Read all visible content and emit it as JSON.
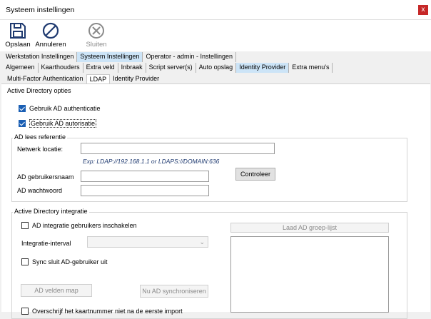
{
  "window": {
    "title": "Systeem instellingen",
    "close": "x"
  },
  "toolbar": {
    "save": "Opslaan",
    "cancel": "Annuleren",
    "close": "Sluiten"
  },
  "tabs_level1": [
    "Werkstation Instellingen",
    "Systeem Instellingen",
    "Operator - admin - Instellingen"
  ],
  "tabs_level2": [
    "Algemeen",
    "Kaarthouders",
    "Extra veld",
    "Inbraak",
    "Script server(s)",
    "Auto opslag",
    "Identity Provider",
    "Extra menu's"
  ],
  "tabs_level3": [
    "Multi-Factor Authentication",
    "LDAP",
    "Identity Provider"
  ],
  "ad_options": {
    "heading": "Active Directory opties",
    "use_auth": {
      "label": "Gebruik AD authenticatie",
      "checked": true
    },
    "use_authz": {
      "label": "Gebruik AD autorisatie",
      "checked": true
    }
  },
  "read_ref": {
    "legend": "AD lees referentie",
    "network_label": "Netwerk locatie:",
    "network_value": "",
    "hint": "Exp: LDAP://192.168.1.1 or LDAPS://DOMAIN:636",
    "username_label": "AD gebruikersnaam",
    "username_value": "",
    "password_label": "AD wachtwoord",
    "password_value": "",
    "check_button": "Controleer"
  },
  "integration": {
    "legend": "Active Directory integratie",
    "enable_label": "AD integratie gebruikers inschakelen",
    "interval_label": "Integratie-interval",
    "sync_close_label": "Sync sluit AD-gebruiker uit",
    "fields_map_button": "AD velden map",
    "sync_now_button": "Nu AD synchroniseren",
    "load_groups_button": "Laad AD groep-lijst",
    "overwrite_label": "Overschrijf het kaartnummer niet na de eerste import"
  },
  "colors": {
    "active_tab": "#cce4f7",
    "checkbox_on": "#1a5fb4",
    "close_red": "#c62828"
  }
}
